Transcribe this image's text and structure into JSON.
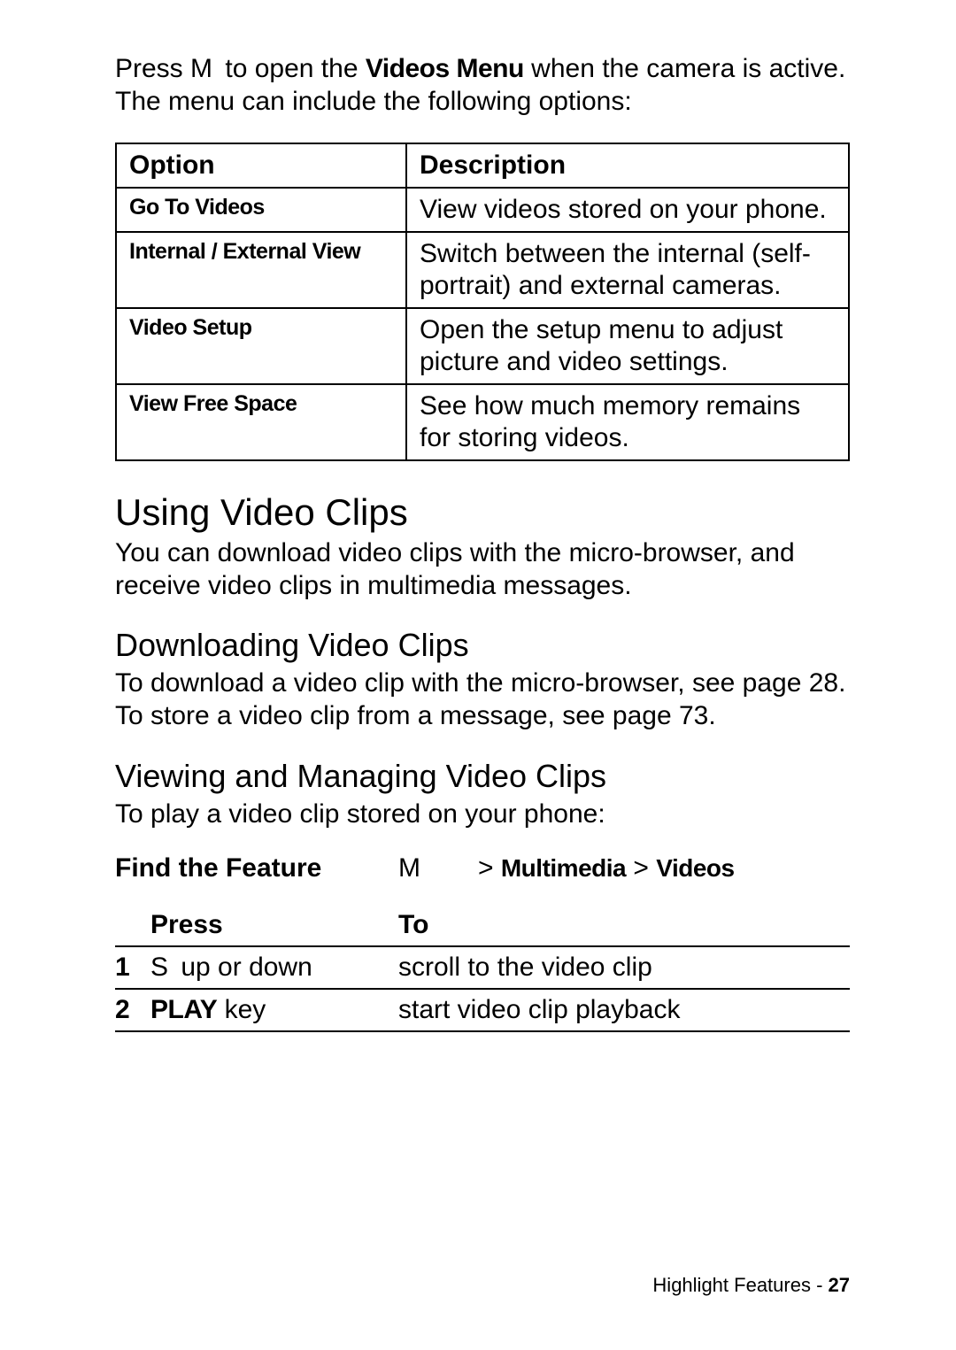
{
  "intro": {
    "prefix": "Press ",
    "key": "M",
    "mid": " to open the ",
    "menu": "Videos Menu",
    "suffix": " when the camera is active. The menu can include the following options:"
  },
  "optionsTable": {
    "headers": {
      "option": "Option",
      "description": "Description"
    },
    "rows": [
      {
        "option": "Go To Videos",
        "description": "View videos stored on your phone."
      },
      {
        "option": "Internal / External View",
        "description": "Switch between the internal (self-portrait) and external cameras."
      },
      {
        "option": "Video Setup",
        "description": "Open the setup menu to adjust picture and video settings."
      },
      {
        "option": "View Free Space",
        "description": "See how much memory remains for storing videos."
      }
    ]
  },
  "sections": {
    "using": {
      "heading": "Using Video Clips",
      "body": "You can download video clips with the micro-browser, and receive video clips in multimedia messages."
    },
    "downloading": {
      "heading": "Downloading Video Clips",
      "body": "To download a video clip with the micro-browser, see page 28. To store a video clip from a message, see page 73."
    },
    "viewing": {
      "heading": "Viewing and Managing Video Clips",
      "body": "To play a video clip stored on your phone:"
    }
  },
  "feature": {
    "label": "Find the Feature",
    "key": "M",
    "pathPrefix": "> ",
    "path1": "Multimedia",
    "pathSep": " > ",
    "path2": "Videos"
  },
  "steps": {
    "headers": {
      "press": "Press",
      "to": "To"
    },
    "rows": [
      {
        "num": "1",
        "pressPrefix": "S",
        "pressSuffix": " up or down",
        "pressBold": "",
        "to": "scroll to the video clip"
      },
      {
        "num": "2",
        "pressPrefix": "",
        "pressBold": "PLAY",
        "pressSuffix": " key",
        "to": "start video clip playback"
      }
    ]
  },
  "footer": {
    "section": "Highlight Features - ",
    "page": "27"
  }
}
